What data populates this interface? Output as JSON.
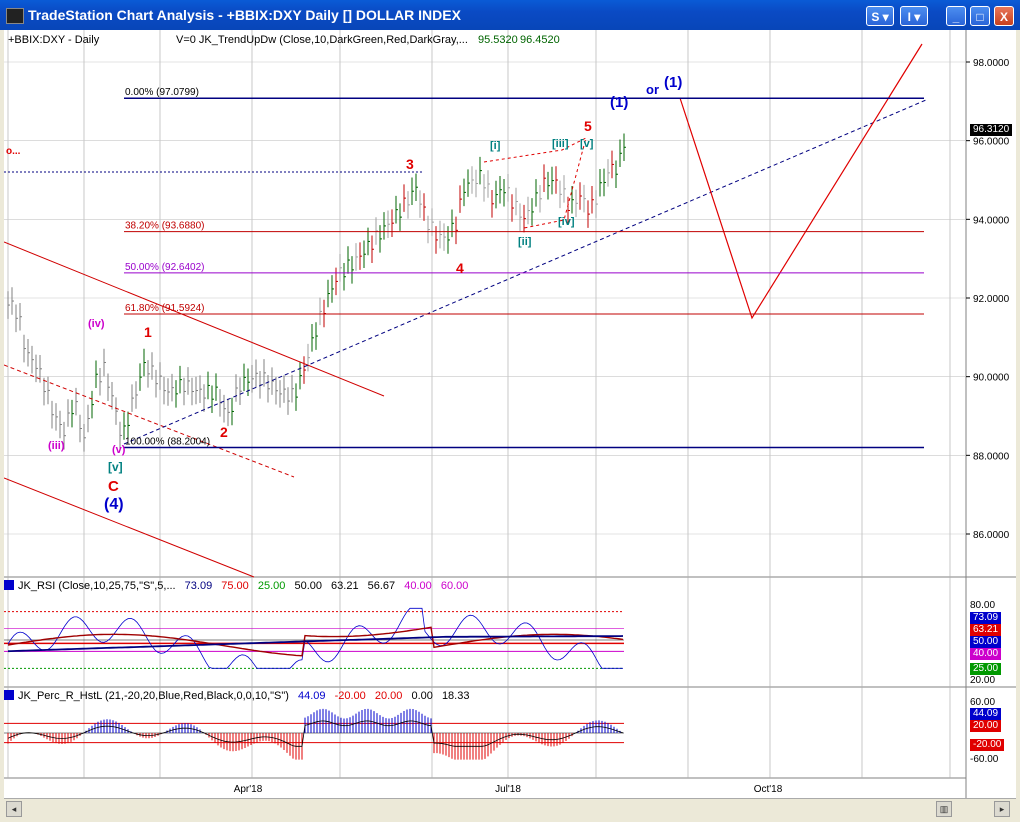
{
  "window": {
    "title": "TradeStation Chart Analysis - +BBIX:DXY Daily [] DOLLAR INDEX",
    "btn_s": "S ▾",
    "btn_i": "I ▾",
    "btn_min": "_",
    "btn_max": "□",
    "btn_close": "X"
  },
  "main_panel": {
    "symbol_label": "+BBIX:DXY - Daily",
    "indicator_label": "V=0  JK_TrendUpDw (Close,10,DarkGreen,Red,DarkGray,...",
    "indicator_v1": "95.5320",
    "indicator_v2": "96.4520",
    "last_price": "96.3120",
    "axis_ticks": [
      "98.0000",
      "96.0000",
      "94.0000",
      "92.0000",
      "90.0000",
      "88.0000",
      "86.0000"
    ],
    "fib_levels": [
      {
        "label": "0.00% (97.0799)",
        "value": 97.0799
      },
      {
        "label": "38.20% (93.6880)",
        "value": 93.688
      },
      {
        "label": "50.00% (92.6402)",
        "value": 92.6402
      },
      {
        "label": "61.80% (91.5924)",
        "value": 91.5924
      },
      {
        "label": "100.00% (88.2004)",
        "value": 88.2004
      }
    ],
    "wave_labels": {
      "w1": "1",
      "w2": "2",
      "w3": "3",
      "w4": "4",
      "w5": "5",
      "iii": "(iii)",
      "iv": "(iv)",
      "v": "(v)",
      "bv": "[v]",
      "C": "C",
      "p4": "(4)",
      "bi": "[i]",
      "bii": "[ii]",
      "biii": "[iii]",
      "biv": "[iv]",
      "bv2": "[v]",
      "p1": "(1)",
      "or_text": "or",
      "or_p1": "(1)",
      "left_mark": "o..."
    }
  },
  "rsi_panel": {
    "label": "JK_RSI (Close,10,25,75,\"S\",5,...",
    "v1": "73.09",
    "v2": "75.00",
    "v3": "25.00",
    "v4": "50.00",
    "v5": "63.21",
    "v6": "56.67",
    "v7": "40.00",
    "v8": "60.00",
    "axis_ticks": [
      "80.00",
      "73.09",
      "63.21",
      "50.00",
      "40.00",
      "25.00",
      "20.00"
    ]
  },
  "perc_panel": {
    "label": "JK_Perc_R_HstL (21,-20,20,Blue,Red,Black,0,0,10,\"S\")",
    "v1": "44.09",
    "v2": "-20.00",
    "v3": "20.00",
    "v4": "0.00",
    "v5": "18.33",
    "axis_ticks": [
      "60.00",
      "44.09",
      "20.00",
      "-20.00",
      "-60.00"
    ]
  },
  "x_axis": {
    "labels": [
      "Apr'18",
      "Jul'18",
      "Oct'18"
    ]
  },
  "colors": {
    "title_blue": "#0a4ac4",
    "grid": "#a0a0a0",
    "red": "#e00000",
    "navy": "#000080",
    "green": "#006400"
  }
}
